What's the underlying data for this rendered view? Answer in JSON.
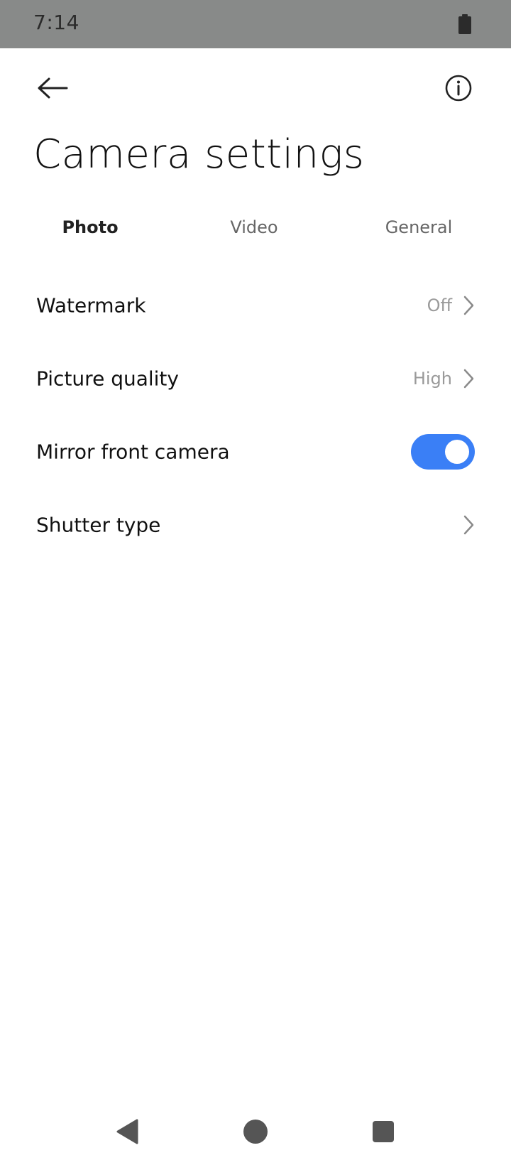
{
  "status_bar": {
    "time": "7:14",
    "battery_icon": "battery-full-icon"
  },
  "header": {
    "back_icon": "arrow-left-icon",
    "info_icon": "info-circle-icon"
  },
  "page": {
    "title": "Camera settings"
  },
  "tabs": [
    {
      "label": "Photo",
      "active": true
    },
    {
      "label": "Video",
      "active": false
    },
    {
      "label": "General",
      "active": false
    }
  ],
  "settings": [
    {
      "label": "Watermark",
      "value": "Off",
      "control": "chevron"
    },
    {
      "label": "Picture quality",
      "value": "High",
      "control": "chevron"
    },
    {
      "label": "Mirror front camera",
      "value": "",
      "control": "toggle",
      "toggle_on": true
    },
    {
      "label": "Shutter type",
      "value": "",
      "control": "chevron"
    }
  ],
  "nav_bar": {
    "back_icon": "triangle-back-icon",
    "home_icon": "circle-home-icon",
    "recents_icon": "square-recents-icon"
  },
  "colors": {
    "accent": "#3a7ff6",
    "status_bar_bg": "#888a89",
    "secondary_text": "#9a9a9a"
  }
}
